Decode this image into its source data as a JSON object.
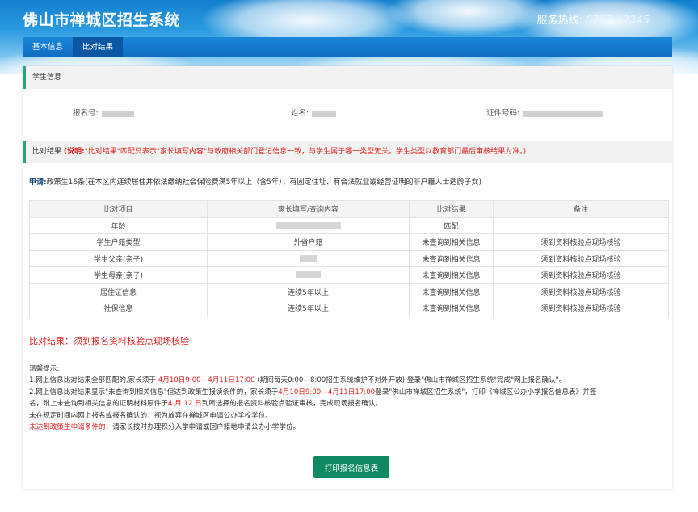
{
  "header": {
    "site_title": "佛山市禅城区招生系统",
    "hotline_label": "服务热线:",
    "hotline_number": "0757-12345"
  },
  "nav": {
    "tabs": [
      {
        "label": "基本信息",
        "active": false
      },
      {
        "label": "比对结果",
        "active": true
      }
    ]
  },
  "student_section": {
    "title": "学生信息",
    "fields": [
      {
        "label": "报名号:",
        "redacted": true
      },
      {
        "label": "姓名:",
        "redacted": true
      },
      {
        "label": "证件号码:",
        "redacted": true
      }
    ]
  },
  "compare_section": {
    "title": "比对结果",
    "note_prefix": "(说明:",
    "note_body": "\"比对结果\"匹配只表示\"家长填写内容\"与政府相关部门登记信息一致，与学生属于哪一类型无关。学生类型以教育部门最后审核结果为准。)"
  },
  "apply": {
    "label": "申请:",
    "text": "政策生16条(在本区内连续居住并依法缴纳社会保险费满5年以上（含5年），有固定住址、有合法就业或经营证明的非户籍人士适龄子女)"
  },
  "table": {
    "headers": [
      "比对项目",
      "家长填写/查询内容",
      "比对结果",
      "备注"
    ],
    "rows": [
      {
        "item": "年龄",
        "content": "",
        "content_redacted": true,
        "result": "匹配",
        "result_status": "ok",
        "remark": ""
      },
      {
        "item": "学生户籍类型",
        "content": "外省户籍",
        "content_redacted": false,
        "result": "未查询到相关信息",
        "result_status": "bad",
        "remark": "须到资料核验点现场核验"
      },
      {
        "item": "学生父亲(亲子)",
        "content": "",
        "content_redacted": true,
        "result": "未查询到相关信息",
        "result_status": "bad",
        "remark": "须到资料核验点现场核验"
      },
      {
        "item": "学生母亲(亲子)",
        "content": "",
        "content_redacted": true,
        "result": "未查询到相关信息",
        "result_status": "bad",
        "remark": "须到资料核验点现场核验"
      },
      {
        "item": "居住证信息",
        "content": "连续5年以上",
        "content_redacted": false,
        "result": "未查询到相关信息",
        "result_status": "bad",
        "remark": "须到资料核验点现场核验"
      },
      {
        "item": "社保信息",
        "content": "连续5年以上",
        "content_redacted": false,
        "result": "未查询到相关信息",
        "result_status": "bad",
        "remark": "须到资料核验点现场核验"
      }
    ]
  },
  "result_line": "比对结果：须到报名资料核验点现场核验",
  "tips": {
    "title": "温馨提示:",
    "line1_a": "1.网上信息比对结果全部匹配的,家长须于",
    "line1_date": "4月10日9:00—4月11日17:00",
    "line1_b": "(期间每天0:00—8:00招生系统维护不对外开放) 登录\"佛山市禅城区招生系统\"完成\"网上报名确认\"。",
    "line2_a": "2.网上信息比对结果显示\"未查询到相关信息\"但达到政策生报读条件的，家长须于",
    "line2_date": "4月10日9:00—4月11日17:00",
    "line2_b": "登录\"佛山市禅城区招生系统\"，打印《禅城区公办小学报名信息表》并签",
    "line3_a": "名，附上未查询到相关信息的证明材料原件于",
    "line3_date": "4 月 12 日",
    "line3_b": "到所选择的报名资料核验点验证审核，完成现场报名确认。",
    "line4": "未在规定时间内网上报名或报名确认的，视为放弃在禅城区申请公办学校学位。",
    "line5_red": "未达到政策生申请条件的，",
    "line5_b": "请家长按时办理积分入学申请或回户籍地申请公办小学学位。"
  },
  "print_button": "打印报名信息表",
  "colors": {
    "primary_blue": "#0f6cc0",
    "accent_green": "#2aa37c",
    "button_green": "#0f8a64",
    "alert_red": "#e02020",
    "match_green": "#1e9a3d"
  }
}
